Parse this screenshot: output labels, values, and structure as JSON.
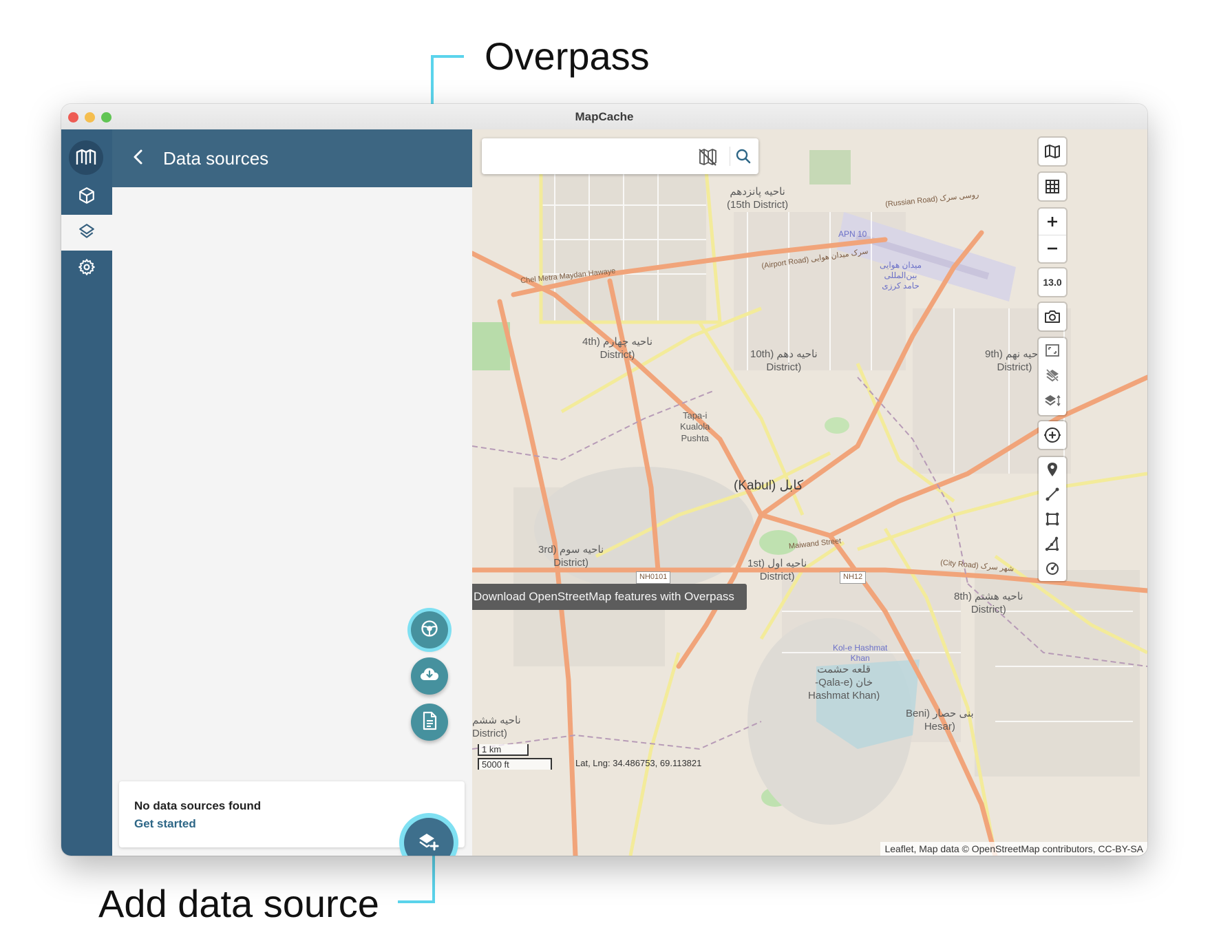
{
  "annotations": {
    "overpass_label": "Overpass",
    "add_source_label": "Add data source",
    "line_color": "#5bd4ec"
  },
  "window": {
    "title": "MapCache"
  },
  "rail": {
    "items": [
      {
        "icon": "mapcache-logo-icon"
      },
      {
        "icon": "cube-icon",
        "label": "GeoPackages"
      },
      {
        "icon": "layers-icon",
        "label": "Data sources",
        "active": true
      },
      {
        "icon": "gear-icon",
        "label": "Settings"
      }
    ],
    "color": "#355f7e"
  },
  "panel": {
    "title": "Data sources",
    "empty_title": "No data sources found",
    "empty_link": "Get started",
    "fab_icons": [
      "overpass-icon",
      "cloud-download-icon",
      "file-icon",
      "add-layer-icon"
    ],
    "header_color": "#3d6682"
  },
  "map": {
    "tooltip": "Download OpenStreetMap features with Overpass",
    "zoom_level": "13.0",
    "scale_km": "1 km",
    "scale_ft": "5000 ft",
    "coordinates": "Lat, Lng: 34.486753, 69.113821",
    "attribution": "Leaflet, Map data © OpenStreetMap contributors, CC-BY-SA",
    "labels": {
      "district_15": "ناحیه پانزدهم\n(15th District)",
      "district_4": "4th) ناحیه چهارم\nDistrict)",
      "district_10": "10th) ناحیه دهم\nDistrict)",
      "district_9": "9th) ناحیه نهم\nDistrict)",
      "district_3": "3rd) ناحیه سوم\nDistrict)",
      "district_1": "1st) ناحیه اول\nDistrict)",
      "district_8": "8th) ناحیه هشتم\nDistrict)",
      "kabul": "(Kabul) کابل",
      "tapa": "Tapa-i\nKualola\nPushta",
      "airport": "میدان هوایی\nبین‌المللی\nحامد کرزی",
      "apn": "APN 10",
      "qala": "قلعه حشمت\n-Qala-e) خان\nHashmat Khan)",
      "kol": "Kol-e Hashmat\nKhan",
      "beni": "Beni) بنی حصار\nHesar)",
      "district_partial": "ناحیه ششم\nDistrict)",
      "nh0101": "NH0101",
      "nh12": "NH12",
      "road_airport": "(Airport Road) سرک میدان هوایی",
      "road_russian": "(Russian Road) روسی سرک",
      "road_chel": "Chel Metra Maydan Hawaye",
      "road_maiwand": "Maiwand Street",
      "road_city": "(City Road) شهر سرک"
    }
  }
}
